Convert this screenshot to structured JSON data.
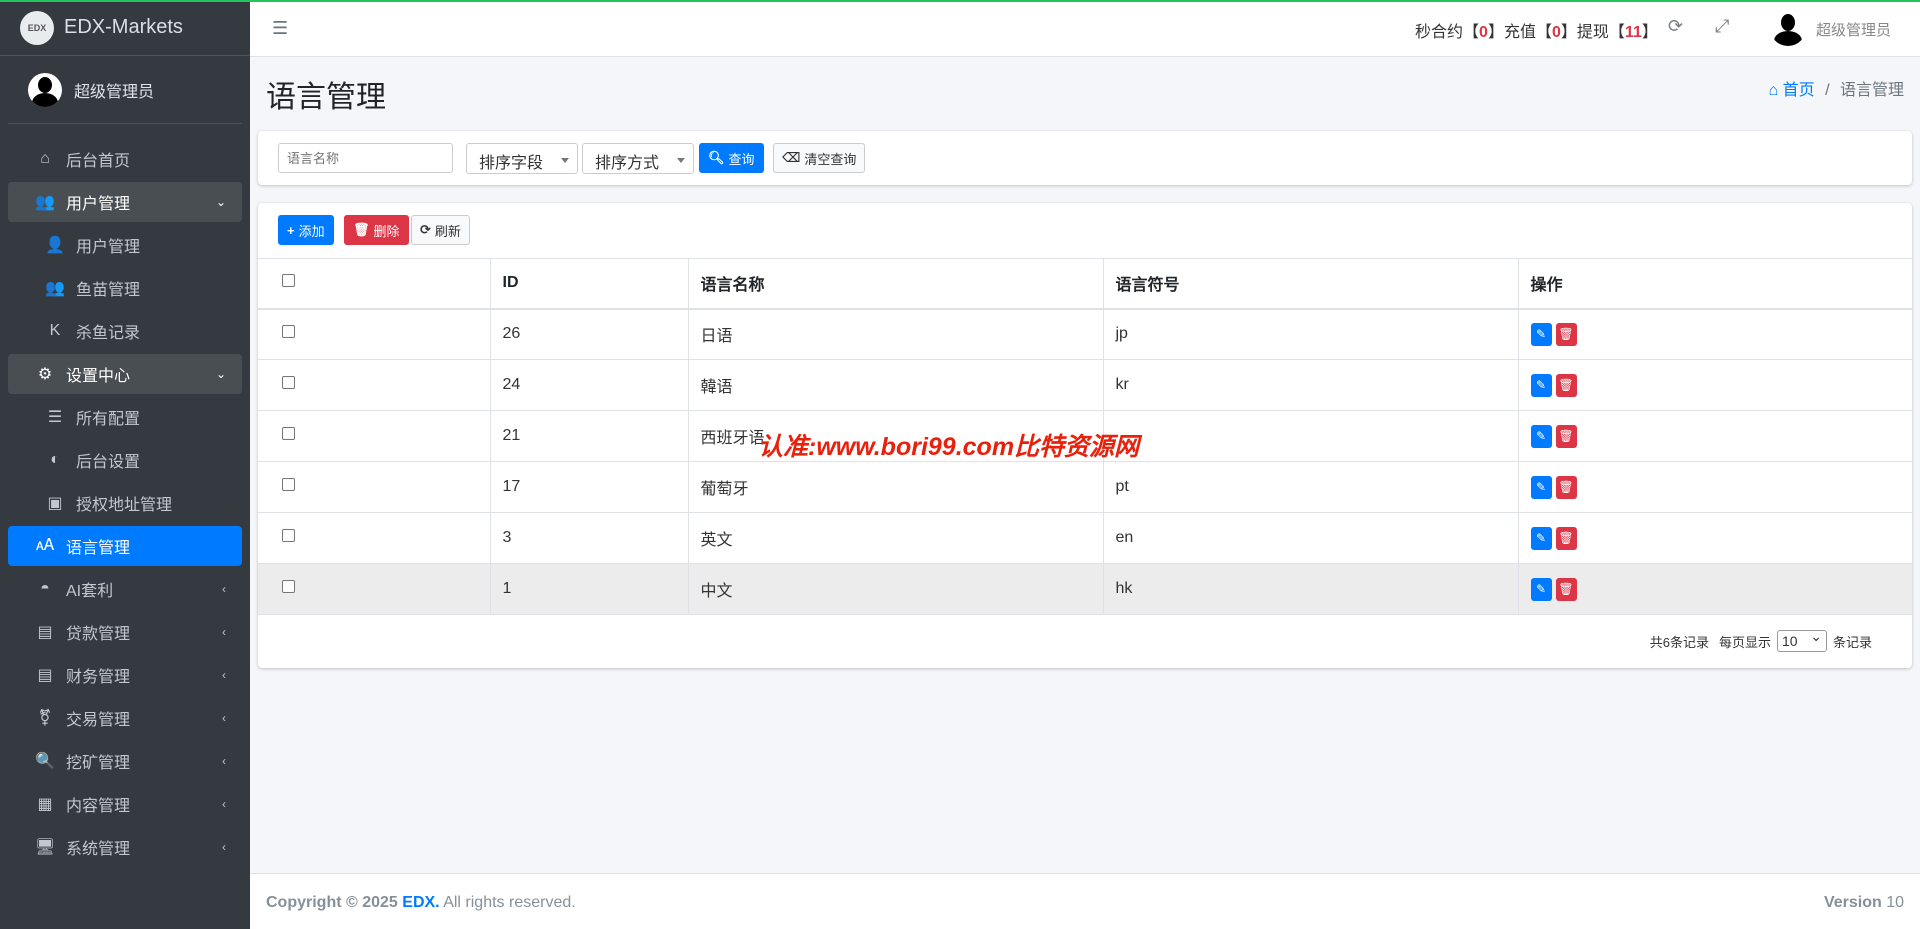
{
  "brand": {
    "logo": "EDX",
    "name": "EDX-Markets"
  },
  "user": {
    "name": "超级管理员"
  },
  "sidebar": [
    {
      "label": "后台首页",
      "icon": "home-icon",
      "glyph": "⌂",
      "state": "",
      "arrow": ""
    },
    {
      "label": "用户管理",
      "icon": "users-icon",
      "glyph": "👥",
      "state": "open",
      "arrow": "⌄"
    },
    {
      "label": "用户管理",
      "icon": "user-icon",
      "glyph": "👤",
      "state": "sub",
      "arrow": ""
    },
    {
      "label": "鱼苗管理",
      "icon": "users-icon",
      "glyph": "👥",
      "state": "sub",
      "arrow": ""
    },
    {
      "label": "杀鱼记录",
      "icon": "k-icon",
      "glyph": "K",
      "state": "sub",
      "arrow": ""
    },
    {
      "label": "设置中心",
      "icon": "cogs-icon",
      "glyph": "⚙",
      "state": "open",
      "arrow": "⌄"
    },
    {
      "label": "所有配置",
      "icon": "list-icon",
      "glyph": "☰",
      "state": "sub",
      "arrow": ""
    },
    {
      "label": "后台设置",
      "icon": "contrast-icon",
      "glyph": "◐",
      "state": "sub",
      "arrow": ""
    },
    {
      "label": "授权地址管理",
      "icon": "address-book-icon",
      "glyph": "▣",
      "state": "sub",
      "arrow": ""
    },
    {
      "label": "语言管理",
      "icon": "language-icon",
      "glyph": "🗚",
      "state": "active",
      "arrow": ""
    },
    {
      "label": "AI套利",
      "icon": "android-icon",
      "glyph": "◓",
      "state": "",
      "arrow": "‹"
    },
    {
      "label": "贷款管理",
      "icon": "money-icon",
      "glyph": "▤",
      "state": "",
      "arrow": "‹"
    },
    {
      "label": "财务管理",
      "icon": "money-icon",
      "glyph": "▤",
      "state": "",
      "arrow": "‹"
    },
    {
      "label": "交易管理",
      "icon": "transgender-icon",
      "glyph": "⚧",
      "state": "",
      "arrow": "‹"
    },
    {
      "label": "挖矿管理",
      "icon": "search-plus-icon",
      "glyph": "🔍",
      "state": "",
      "arrow": "‹"
    },
    {
      "label": "内容管理",
      "icon": "newspaper-icon",
      "glyph": "▦",
      "state": "",
      "arrow": "‹"
    },
    {
      "label": "系统管理",
      "icon": "desktop-icon",
      "glyph": "🖥",
      "state": "",
      "arrow": "‹"
    }
  ],
  "header": {
    "stats": [
      {
        "label": "秒合约",
        "value": "0"
      },
      {
        "label": "充值",
        "value": "0"
      },
      {
        "label": "提现",
        "value": "11"
      }
    ],
    "user": "超级管理员"
  },
  "page": {
    "title": "语言管理",
    "breadcrumb_home": "首页",
    "breadcrumb_current": "语言管理"
  },
  "search": {
    "placeholder": "语言名称",
    "sort_field": "排序字段",
    "sort_order": "排序方式",
    "query": "查询",
    "clear": "清空查询"
  },
  "toolbar": {
    "add": "添加",
    "delete": "删除",
    "refresh": "刷新"
  },
  "table": {
    "headers": [
      "",
      "ID",
      "语言名称",
      "语言符号",
      "操作"
    ],
    "rows": [
      {
        "id": "26",
        "name": "日语",
        "symbol": "jp"
      },
      {
        "id": "24",
        "name": "韓语",
        "symbol": "kr"
      },
      {
        "id": "21",
        "name": "西班牙语",
        "symbol": ""
      },
      {
        "id": "17",
        "name": "葡萄牙",
        "symbol": "pt"
      },
      {
        "id": "3",
        "name": "英文",
        "symbol": "en"
      },
      {
        "id": "1",
        "name": "中文",
        "symbol": "hk"
      }
    ]
  },
  "pager": {
    "total": "共6条记录",
    "per_page_label": "每页显示",
    "per_page": "10",
    "suffix": "条记录"
  },
  "watermark": "认准:www.bori99.com比特资源网",
  "footer": {
    "copyright": "Copyright © 2025",
    "brand": "EDX.",
    "rights": "All rights reserved.",
    "version_label": "Version",
    "version": "10"
  }
}
